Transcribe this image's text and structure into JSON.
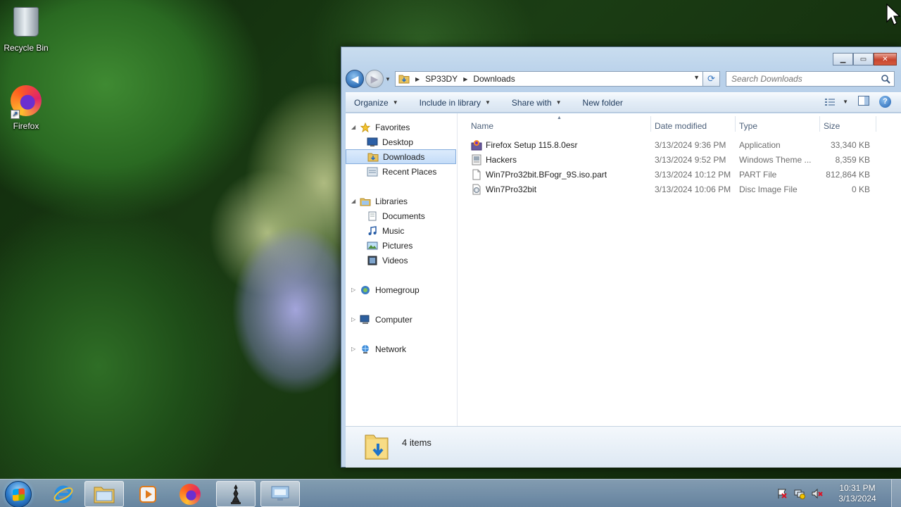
{
  "desktop": {
    "icons": [
      {
        "label": "Recycle Bin"
      },
      {
        "label": "Firefox"
      }
    ]
  },
  "window": {
    "address": {
      "crumbs": [
        "SP33DY",
        "Downloads"
      ]
    },
    "search": {
      "placeholder": "Search Downloads"
    },
    "toolbar": {
      "organize": "Organize",
      "include": "Include in library",
      "share": "Share with",
      "new_folder": "New folder"
    },
    "nav": {
      "favorites": "Favorites",
      "favorites_items": [
        "Desktop",
        "Downloads",
        "Recent Places"
      ],
      "libraries": "Libraries",
      "libraries_items": [
        "Documents",
        "Music",
        "Pictures",
        "Videos"
      ],
      "homegroup": "Homegroup",
      "computer": "Computer",
      "network": "Network"
    },
    "columns": {
      "name": "Name",
      "date": "Date modified",
      "type": "Type",
      "size": "Size"
    },
    "files": [
      {
        "name": "Firefox Setup 115.8.0esr",
        "date": "3/13/2024 9:36 PM",
        "type": "Application",
        "size": "33,340 KB",
        "icon": "firefox-installer-icon"
      },
      {
        "name": "Hackers",
        "date": "3/13/2024 9:52 PM",
        "type": "Windows Theme ...",
        "size": "8,359 KB",
        "icon": "theme-file-icon"
      },
      {
        "name": "Win7Pro32bit.BFogr_9S.iso.part",
        "date": "3/13/2024 10:12 PM",
        "type": "PART File",
        "size": "812,864 KB",
        "icon": "blank-file-icon"
      },
      {
        "name": "Win7Pro32bit",
        "date": "3/13/2024 10:06 PM",
        "type": "Disc Image File",
        "size": "0 KB",
        "icon": "disc-image-icon"
      }
    ],
    "status": {
      "count": "4 items"
    }
  },
  "taskbar": {
    "clock": {
      "time": "10:31 PM",
      "date": "3/13/2024"
    }
  }
}
